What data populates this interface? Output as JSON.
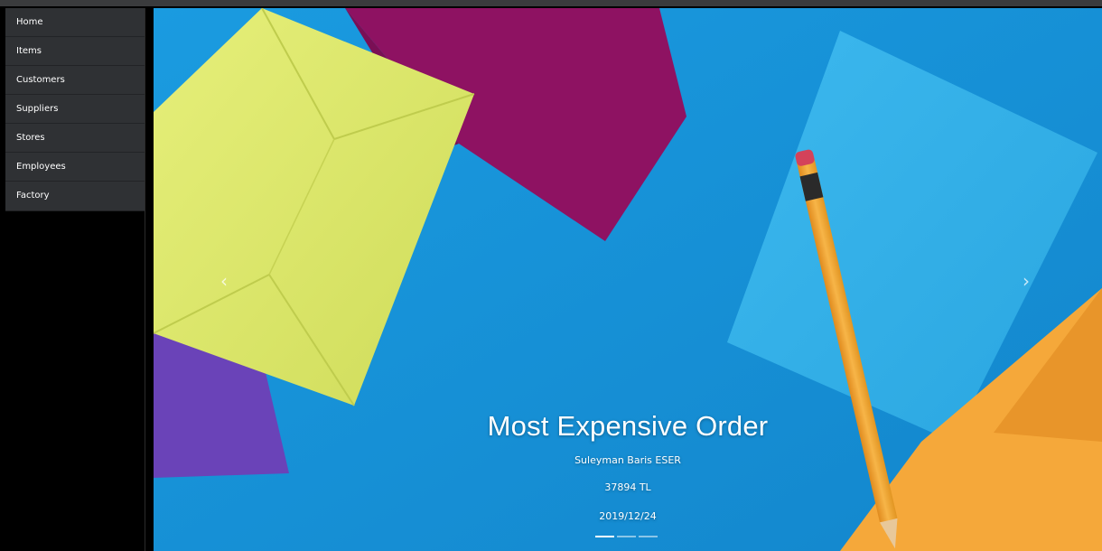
{
  "sidebar": {
    "items": [
      {
        "label": "Home"
      },
      {
        "label": "Items"
      },
      {
        "label": "Customers"
      },
      {
        "label": "Suppliers"
      },
      {
        "label": "Stores"
      },
      {
        "label": "Employees"
      },
      {
        "label": "Factory"
      }
    ]
  },
  "carousel": {
    "slide": {
      "title": "Most Expensive Order",
      "customer": "Suleyman Baris ESER",
      "amount": "37894 TL",
      "date": "2019/12/24"
    },
    "prev_icon": "chevron-left-icon",
    "next_icon": "chevron-right-icon",
    "indicator_count": 3,
    "active_indicator": 0
  },
  "colors": {
    "sidebar_bg": "#2f3134",
    "background": "#1893d7",
    "envelope_yellow": "#dde86a",
    "envelope_magenta": "#8e1262",
    "envelope_purple": "#6a43b8",
    "envelope_lightblue": "#36b2e8",
    "envelope_orange": "#f5a83a",
    "pencil_orange": "#f0a93a"
  }
}
